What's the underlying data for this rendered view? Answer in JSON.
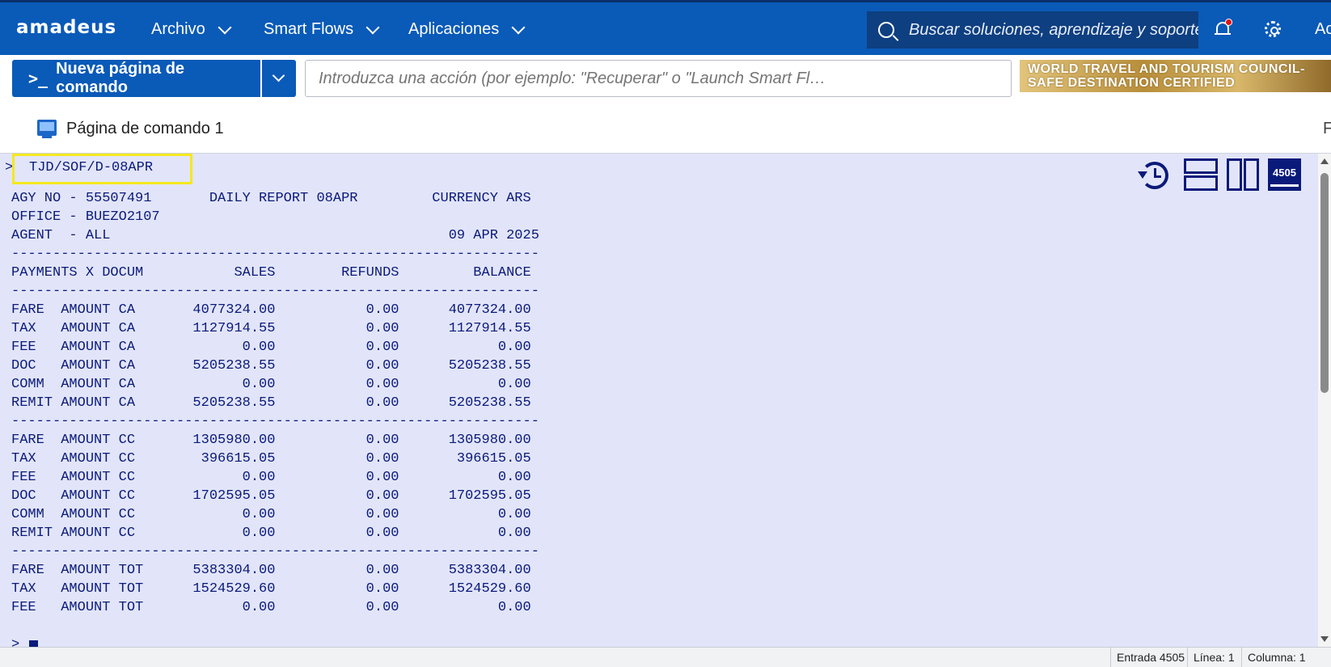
{
  "topbar": {
    "logo": "amadeus",
    "menus": [
      {
        "label": "Archivo"
      },
      {
        "label": "Smart Flows"
      },
      {
        "label": "Aplicaciones"
      }
    ],
    "search_placeholder": "Buscar soluciones, aprendizaje y soporte",
    "account_label": "Ac"
  },
  "cmdbar": {
    "new_command_prompt": ">_",
    "new_command_label": "Nueva página de comando",
    "action_placeholder": "Introduzca una acción (por ejemplo: \"Recuperar\" o \"Launch Smart Fl…",
    "banner_line1": "WORLD TRAVEL AND TOURISM COUNCIL-",
    "banner_line2": "SAFE DESTINATION CERTIFIED"
  },
  "tab": {
    "label": "Página de comando 1",
    "right_clip": "F"
  },
  "terminal": {
    "prompt": ">",
    "command": "TJD/SOF/D-08APR",
    "entry_badge": "4505",
    "lines": [
      "AGY NO - 55507491       DAILY REPORT 08APR         CURRENCY ARS",
      "OFFICE - BUEZO2107",
      "AGENT  - ALL                                         09 APR 2025",
      "----------------------------------------------------------------",
      "PAYMENTS X DOCUM           SALES        REFUNDS         BALANCE",
      "----------------------------------------------------------------",
      "FARE  AMOUNT CA       4077324.00           0.00      4077324.00",
      "TAX   AMOUNT CA       1127914.55           0.00      1127914.55",
      "FEE   AMOUNT CA             0.00           0.00            0.00",
      "DOC   AMOUNT CA       5205238.55           0.00      5205238.55",
      "COMM  AMOUNT CA             0.00           0.00            0.00",
      "REMIT AMOUNT CA       5205238.55           0.00      5205238.55",
      "----------------------------------------------------------------",
      "FARE  AMOUNT CC       1305980.00           0.00      1305980.00",
      "TAX   AMOUNT CC        396615.05           0.00       396615.05",
      "FEE   AMOUNT CC             0.00           0.00            0.00",
      "DOC   AMOUNT CC       1702595.05           0.00      1702595.05",
      "COMM  AMOUNT CC             0.00           0.00            0.00",
      "REMIT AMOUNT CC             0.00           0.00            0.00",
      "----------------------------------------------------------------",
      "FARE  AMOUNT TOT      5383304.00           0.00      5383304.00",
      "TAX   AMOUNT TOT      1524529.60           0.00      1524529.60",
      "FEE   AMOUNT TOT            0.00           0.00            0.00"
    ]
  },
  "statusbar": {
    "entry": "Entrada 4505",
    "line": "Línea: 1",
    "column": "Columna: 1"
  },
  "colors": {
    "brand_blue": "#0a5ab8",
    "terminal_bg": "#e2e5f9",
    "terminal_text": "#0a1a7a",
    "highlight_box": "#f5e81e"
  }
}
